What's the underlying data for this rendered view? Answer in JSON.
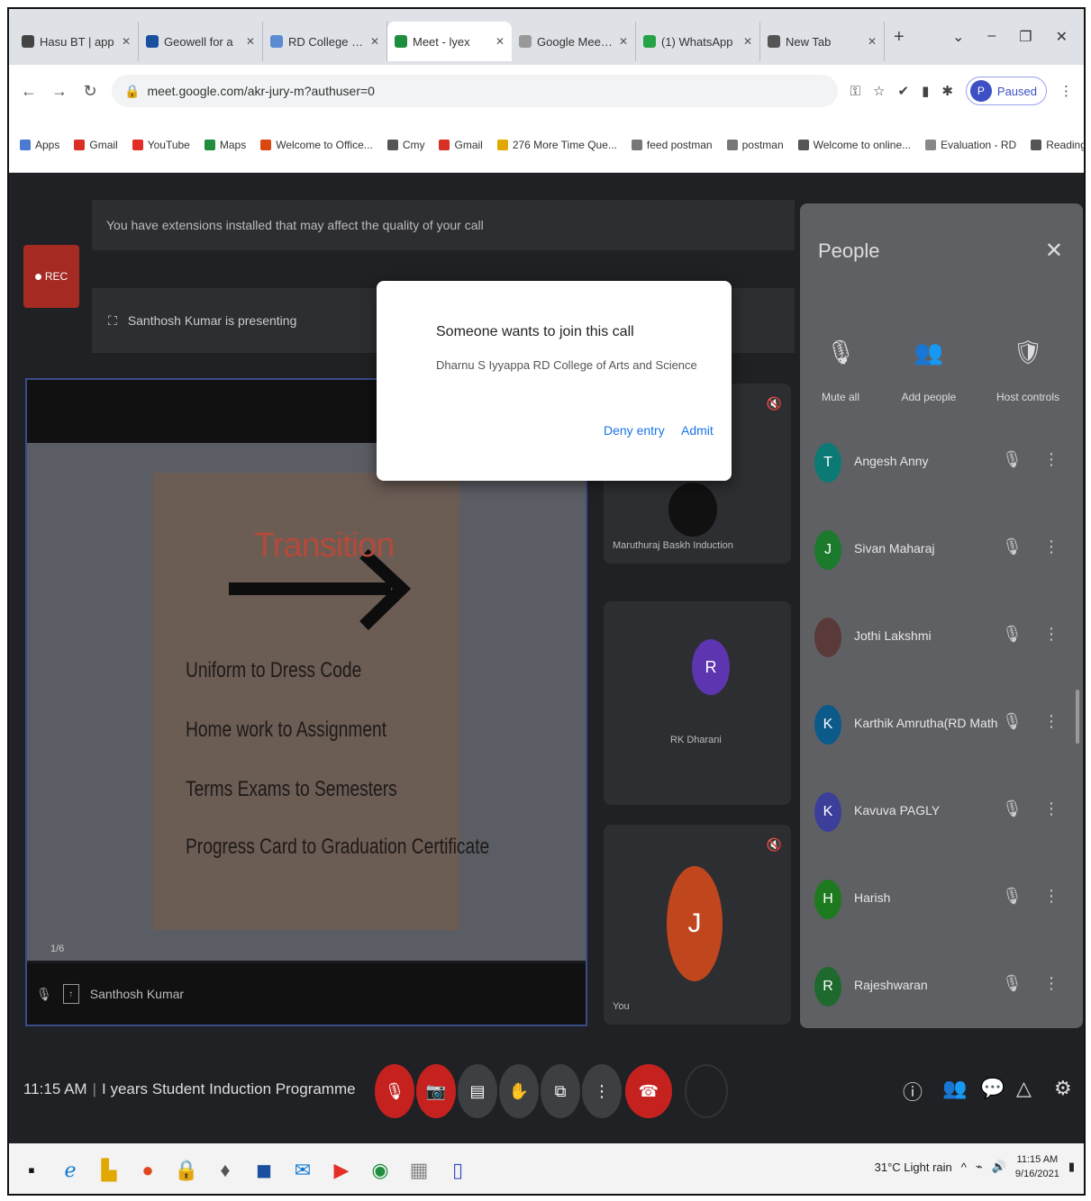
{
  "browser": {
    "tabs": [
      {
        "label": "Hasu BT | app",
        "color": "#444",
        "active": false
      },
      {
        "label": "Geowell for a",
        "color": "#1a4fa0",
        "active": false
      },
      {
        "label": "RD College of Ar",
        "color": "#5a8ad0",
        "active": false
      },
      {
        "label": "Meet - lyex",
        "color": "#1e8e3e",
        "active": true
      },
      {
        "label": "Google Meet fo",
        "color": "#999",
        "active": false
      },
      {
        "label": "(1) WhatsApp",
        "color": "#25a244",
        "active": false
      },
      {
        "label": "New Tab",
        "color": "#555",
        "active": false
      }
    ],
    "window_controls": [
      "⌄",
      "–",
      "❐",
      "✕"
    ],
    "url": "meet.google.com/akr-jury-m?authuser=0",
    "profile": {
      "initial": "P",
      "label": "Paused"
    },
    "bookmarks": [
      {
        "label": "Apps",
        "color": "#4a7bd0"
      },
      {
        "label": "Gmail",
        "color": "#d93025"
      },
      {
        "label": "YouTube",
        "color": "#e52d27"
      },
      {
        "label": "Maps",
        "color": "#1e8e3e"
      },
      {
        "label": "Welcome to Office...",
        "color": "#d9480f"
      },
      {
        "label": "Cmy",
        "color": "#555"
      },
      {
        "label": "Gmail",
        "color": "#d93025"
      },
      {
        "label": "276 More Time Que...",
        "color": "#e0a800"
      },
      {
        "label": "feed postman",
        "color": "#777"
      },
      {
        "label": "postman",
        "color": "#777"
      },
      {
        "label": "Welcome to online...",
        "color": "#555"
      },
      {
        "label": "Evaluation - RD",
        "color": "#888"
      },
      {
        "label": "Reading list",
        "color": "#555"
      }
    ]
  },
  "meet": {
    "warning": "You have extensions installed that may affect the quality of your call",
    "rec_label": "REC",
    "presenting": "Santhosh Kumar is presenting",
    "slide": {
      "title": "Transition",
      "lines": [
        "Uniform to Dress Code",
        "Home work to Assignment",
        "Terms Exams to Semesters",
        "Progress Card to Graduation Certificate"
      ],
      "page": "1/6"
    },
    "presenter_name": "Santhosh Kumar",
    "tiles": [
      {
        "name": "Maruthuraj Baskh Induction",
        "initial": "",
        "color": "#333"
      },
      {
        "name": "RK Dharani",
        "initial": "R",
        "color": "#5e35b1"
      },
      {
        "name": "You",
        "initial": "J",
        "color": "#c0461e"
      }
    ],
    "dialog": {
      "title": "Someone wants to join this call",
      "subtitle": "Dharnu S Iyyappa RD College of Arts and Science",
      "deny": "Deny entry",
      "admit": "Admit"
    },
    "people": {
      "title": "People",
      "actions": [
        {
          "icon": "🎙",
          "label": "Mute all"
        },
        {
          "icon": "👥",
          "label": "Add people"
        },
        {
          "icon": "🛡",
          "label": "Host controls"
        }
      ],
      "participants": [
        {
          "name": "Angesh Anny",
          "initial": "T",
          "color": "#0b7a75"
        },
        {
          "name": "Sivan Maharaj",
          "initial": "J",
          "color": "#1b7a2c"
        },
        {
          "name": "Jothi Lakshmi",
          "initial": "",
          "color": "#5a3a38"
        },
        {
          "name": "Karthik Amrutha(RD Math)",
          "initial": "K",
          "color": "#0b5a8a"
        },
        {
          "name": "Kavuva PAGLY",
          "initial": "K",
          "color": "#3b3f9a"
        },
        {
          "name": "Harish",
          "initial": "H",
          "color": "#1e7a1e"
        },
        {
          "name": "Rajeshwaran",
          "initial": "R",
          "color": "#1e6a2e"
        }
      ]
    },
    "time": "11:15 AM",
    "meeting_title": "I years Student Induction Programme"
  },
  "taskbar": {
    "weather": "31°C Light rain",
    "clock_time": "11:15 AM",
    "clock_date": "9/16/2021"
  }
}
